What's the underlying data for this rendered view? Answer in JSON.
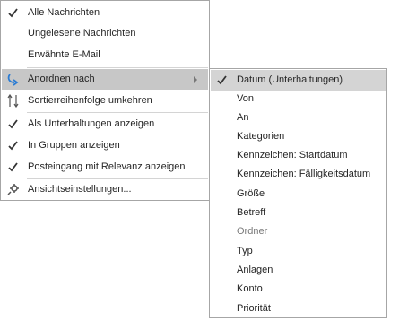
{
  "main_menu": {
    "items": [
      {
        "label": "Alle Nachrichten",
        "checked": true
      },
      {
        "label": "Ungelesene Nachrichten",
        "checked": false
      },
      {
        "label": "Erwähnte E-Mail",
        "checked": false
      },
      {
        "label": "Anordnen nach",
        "icon": "sort-arrow-icon",
        "submenu": true,
        "highlighted": true
      },
      {
        "label": "Sortierreihenfolge umkehren",
        "icon": "reverse-sort-icon"
      },
      {
        "label": "Als Unterhaltungen anzeigen",
        "checked": true
      },
      {
        "label": "In Gruppen anzeigen",
        "checked": true
      },
      {
        "label": "Posteingang mit Relevanz anzeigen",
        "checked": true
      },
      {
        "label": "Ansichtseinstellungen...",
        "icon": "view-settings-icon"
      }
    ]
  },
  "submenu": {
    "items": [
      {
        "label": "Datum (Unterhaltungen)",
        "checked": true
      },
      {
        "label": "Von"
      },
      {
        "label": "An"
      },
      {
        "label": "Kategorien"
      },
      {
        "label": "Kennzeichen: Startdatum"
      },
      {
        "label": "Kennzeichen: Fälligkeitsdatum"
      },
      {
        "label": "Größe"
      },
      {
        "label": "Betreff"
      },
      {
        "label": "Ordner",
        "disabled": true
      },
      {
        "label": "Typ"
      },
      {
        "label": "Anlagen"
      },
      {
        "label": "Konto"
      },
      {
        "label": "Priorität"
      }
    ]
  },
  "colors": {
    "accent_blue": "#2b7cd3",
    "highlight": "#c7c7c7",
    "border": "#a6a6a6",
    "disabled_text": "#7a7a7a"
  }
}
